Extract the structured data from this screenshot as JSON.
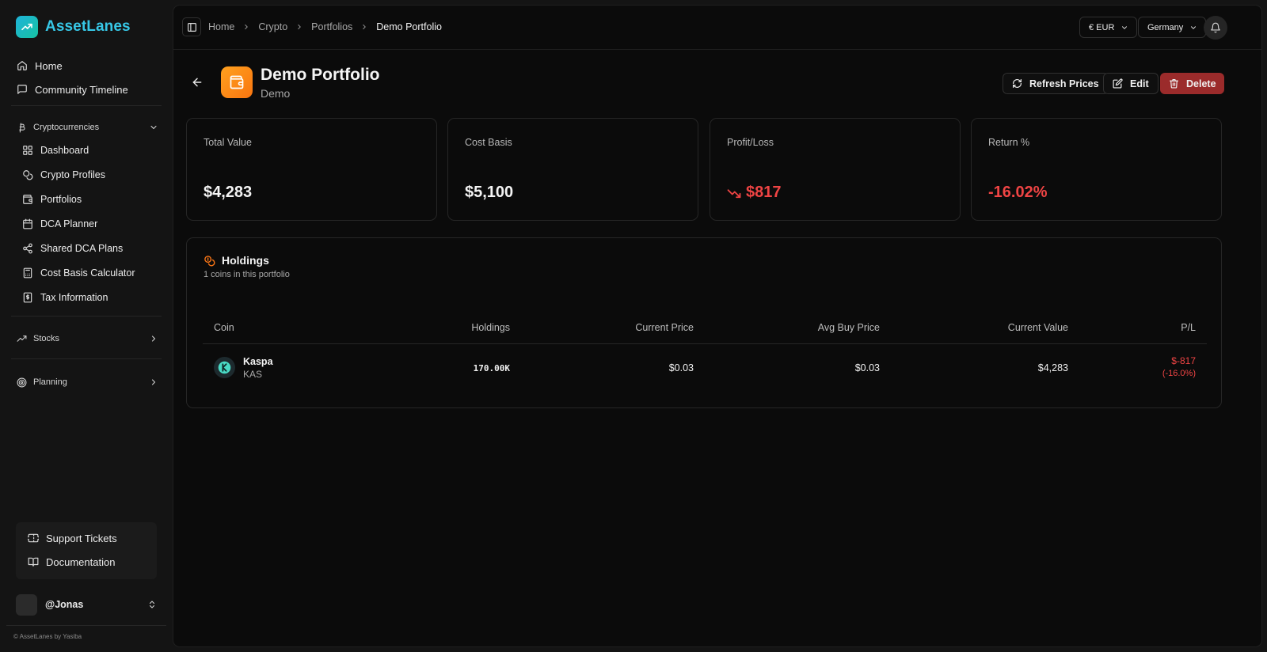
{
  "app": {
    "name": "AssetLanes",
    "footer": "© AssetLanes by Yasiba"
  },
  "sidebar": {
    "top_items": [
      {
        "label": "Home",
        "icon": "home-icon"
      },
      {
        "label": "Community Timeline",
        "icon": "message-square-icon"
      }
    ],
    "crypto_section": {
      "label": "Cryptocurrencies",
      "items": [
        {
          "label": "Dashboard",
          "icon": "grid-icon"
        },
        {
          "label": "Crypto Profiles",
          "icon": "coins-icon"
        },
        {
          "label": "Portfolios",
          "icon": "wallet-icon"
        },
        {
          "label": "DCA Planner",
          "icon": "calendar-icon"
        },
        {
          "label": "Shared DCA Plans",
          "icon": "share-icon"
        },
        {
          "label": "Cost Basis Calculator",
          "icon": "calculator-icon"
        },
        {
          "label": "Tax Information",
          "icon": "receipt-icon"
        }
      ]
    },
    "stocks_section": {
      "label": "Stocks"
    },
    "planning_section": {
      "label": "Planning"
    },
    "support_items": [
      {
        "label": "Support Tickets",
        "icon": "ticket-icon"
      },
      {
        "label": "Documentation",
        "icon": "book-icon"
      }
    ],
    "user": {
      "name": "@Jonas"
    }
  },
  "topbar": {
    "breadcrumb": [
      "Home",
      "Crypto",
      "Portfolios",
      "Demo Portfolio"
    ],
    "currency": "€ EUR",
    "country": "Germany"
  },
  "portfolio": {
    "title": "Demo Portfolio",
    "subtitle": "Demo",
    "actions": {
      "refresh": "Refresh Prices",
      "edit": "Edit",
      "delete": "Delete"
    }
  },
  "stats": {
    "total_value": {
      "label": "Total Value",
      "value": "$4,283"
    },
    "cost_basis": {
      "label": "Cost Basis",
      "value": "$5,100"
    },
    "profit_loss": {
      "label": "Profit/Loss",
      "value": "$817"
    },
    "return_pct": {
      "label": "Return %",
      "value": "-16.02%"
    }
  },
  "holdings": {
    "title": "Holdings",
    "subtitle": "1 coins in this portfolio",
    "columns": [
      "Coin",
      "Holdings",
      "Current Price",
      "Avg Buy Price",
      "Current Value",
      "P/L"
    ],
    "rows": [
      {
        "coin": "Kaspa",
        "symbol": "KAS",
        "holdings": "170.00K",
        "current_price": "$0.03",
        "avg_buy_price": "$0.03",
        "current_value": "$4,283",
        "pl": "$-817",
        "pl_pct": "(-16.0%)"
      }
    ]
  },
  "colors": {
    "accent": "#37c7e6",
    "negative": "#ef4444",
    "portfolio_icon": "#f97510",
    "delete_button": "#9b2b2b"
  }
}
